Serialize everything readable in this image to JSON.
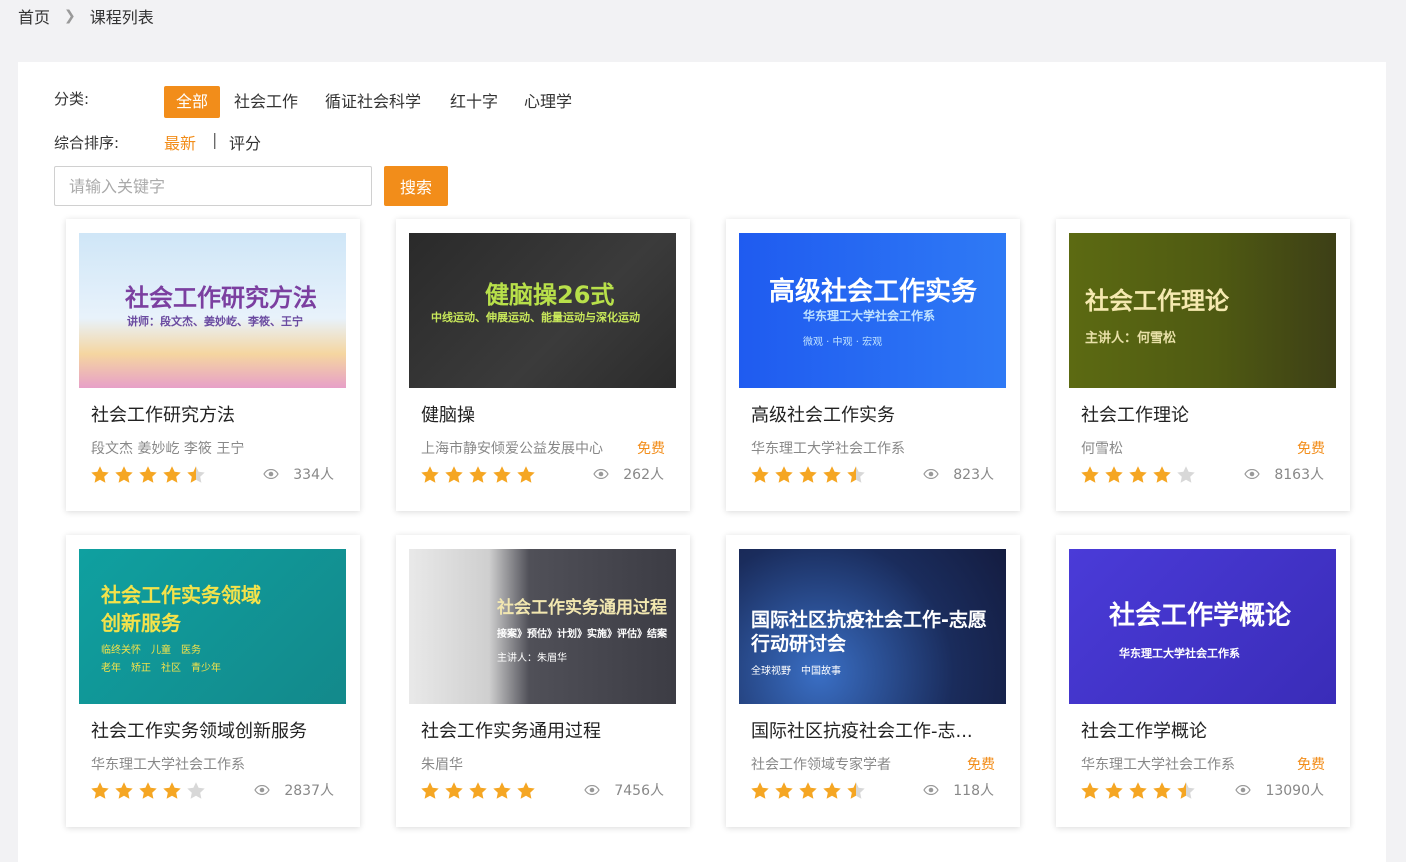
{
  "breadcrumb": {
    "home": "首页",
    "current": "课程列表"
  },
  "filters": {
    "category_label": "分类:",
    "categories": [
      "全部",
      "社会工作",
      "循证社会科学",
      "红十字",
      "心理学"
    ],
    "sort_label": "综合排序:",
    "sort_options": [
      "最新",
      "评分"
    ],
    "sort_separator": "|"
  },
  "search": {
    "placeholder": "请输入关键字",
    "button": "搜索"
  },
  "colors": {
    "accent": "#f28d1a",
    "star": "#f5a623",
    "star_empty": "#d8d8d8"
  },
  "courses": [
    {
      "title": "社会工作研究方法",
      "author": "段文杰 姜妙屹 李筱 王宁",
      "free": "",
      "rating": 4.5,
      "views": "334人",
      "thumb": {
        "main": "社会工作研究方法",
        "sub": "讲师：段文杰、姜妙屹、李筱、王宁",
        "sub2": "",
        "sub3": ""
      }
    },
    {
      "title": "健脑操",
      "author": "上海市静安倾爱公益发展中心",
      "free": "免费",
      "rating": 5,
      "views": "262人",
      "thumb": {
        "main": "健脑操26式",
        "sub": "中线运动、伸展运动、能量运动与深化运动",
        "sub2": "",
        "sub3": ""
      }
    },
    {
      "title": "高级社会工作实务",
      "author": "华东理工大学社会工作系",
      "free": "",
      "rating": 4.5,
      "views": "823人",
      "thumb": {
        "main": "高级社会工作实务",
        "sub": "华东理工大学社会工作系",
        "sub2": "微观 · 中观 · 宏观",
        "sub3": ""
      }
    },
    {
      "title": "社会工作理论",
      "author": "何雪松",
      "free": "免费",
      "rating": 4,
      "views": "8163人",
      "thumb": {
        "main": "社会工作理论",
        "sub": "主讲人：何雪松",
        "sub2": "",
        "sub3": ""
      }
    },
    {
      "title": "社会工作实务领域创新服务",
      "author": "华东理工大学社会工作系",
      "free": "",
      "rating": 4,
      "views": "2837人",
      "thumb": {
        "main": "社会工作实务领域",
        "sub": "创新服务",
        "sub2": "临终关怀　儿童　医务",
        "sub3": "老年　矫正　社区　青少年"
      }
    },
    {
      "title": "社会工作实务通用过程",
      "author": "朱眉华",
      "free": "",
      "rating": 5,
      "views": "7456人",
      "thumb": {
        "main": "社会工作实务通用过程",
        "sub": "接案》预估》计划》实施》评估》结案",
        "sub2": "主讲人：朱眉华",
        "sub3": ""
      }
    },
    {
      "title": "国际社区抗疫社会工作-志...",
      "author": "社会工作领域专家学者",
      "free": "免费",
      "rating": 4.5,
      "views": "118人",
      "thumb": {
        "main": "国际社区抗疫社会工作-志愿",
        "sub": "行动研讨会",
        "sub2": "全球视野　中国故事",
        "sub3": ""
      }
    },
    {
      "title": "社会工作学概论",
      "author": "华东理工大学社会工作系",
      "free": "免费",
      "rating": 4.5,
      "views": "13090人",
      "thumb": {
        "main": "社会工作学概论",
        "sub": "华东理工大学社会工作系",
        "sub2": "",
        "sub3": ""
      }
    }
  ]
}
